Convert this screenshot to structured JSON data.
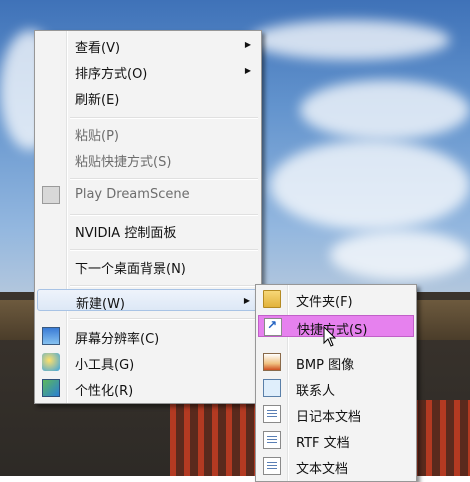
{
  "context_menu": {
    "items": [
      {
        "label": "查看(V)",
        "submenu": true
      },
      {
        "label": "排序方式(O)",
        "submenu": true
      },
      {
        "label": "刷新(E)"
      },
      {
        "label": "粘贴(P)",
        "disabled": true
      },
      {
        "label": "粘贴快捷方式(S)",
        "disabled": true
      },
      {
        "label": "Play DreamScene",
        "disabled": true,
        "icon": "dreamscene-icon"
      },
      {
        "label": "NVIDIA 控制面板"
      },
      {
        "label": "下一个桌面背景(N)"
      },
      {
        "label": "新建(W)",
        "submenu": true,
        "state": "hover"
      },
      {
        "label": "屏幕分辨率(C)",
        "icon": "screen-resolution-icon"
      },
      {
        "label": "小工具(G)",
        "icon": "gadgets-icon"
      },
      {
        "label": "个性化(R)",
        "icon": "personalize-icon"
      }
    ]
  },
  "new_submenu": {
    "items": [
      {
        "label": "文件夹(F)",
        "icon": "folder-icon"
      },
      {
        "label": "快捷方式(S)",
        "icon": "shortcut-icon",
        "state": "highlighted",
        "highlight_color": "#e681ee"
      },
      {
        "label": "BMP 图像",
        "icon": "bmp-image-icon"
      },
      {
        "label": "联系人",
        "icon": "contact-icon"
      },
      {
        "label": "日记本文档",
        "icon": "journal-document-icon"
      },
      {
        "label": "RTF 文档",
        "icon": "rtf-document-icon"
      },
      {
        "label": "文本文档",
        "icon": "text-document-icon"
      }
    ]
  }
}
